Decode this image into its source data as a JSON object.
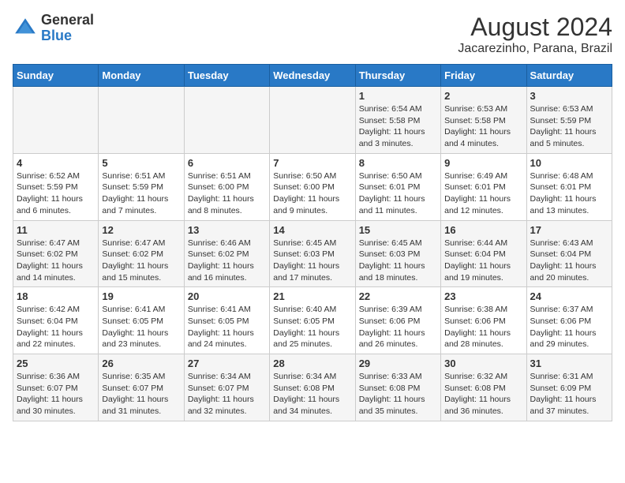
{
  "header": {
    "logo_general": "General",
    "logo_blue": "Blue",
    "month_title": "August 2024",
    "location": "Jacarezinho, Parana, Brazil"
  },
  "days_of_week": [
    "Sunday",
    "Monday",
    "Tuesday",
    "Wednesday",
    "Thursday",
    "Friday",
    "Saturday"
  ],
  "weeks": [
    [
      {
        "day": "",
        "info": ""
      },
      {
        "day": "",
        "info": ""
      },
      {
        "day": "",
        "info": ""
      },
      {
        "day": "",
        "info": ""
      },
      {
        "day": "1",
        "info": "Sunrise: 6:54 AM\nSunset: 5:58 PM\nDaylight: 11 hours and 3 minutes."
      },
      {
        "day": "2",
        "info": "Sunrise: 6:53 AM\nSunset: 5:58 PM\nDaylight: 11 hours and 4 minutes."
      },
      {
        "day": "3",
        "info": "Sunrise: 6:53 AM\nSunset: 5:59 PM\nDaylight: 11 hours and 5 minutes."
      }
    ],
    [
      {
        "day": "4",
        "info": "Sunrise: 6:52 AM\nSunset: 5:59 PM\nDaylight: 11 hours and 6 minutes."
      },
      {
        "day": "5",
        "info": "Sunrise: 6:51 AM\nSunset: 5:59 PM\nDaylight: 11 hours and 7 minutes."
      },
      {
        "day": "6",
        "info": "Sunrise: 6:51 AM\nSunset: 6:00 PM\nDaylight: 11 hours and 8 minutes."
      },
      {
        "day": "7",
        "info": "Sunrise: 6:50 AM\nSunset: 6:00 PM\nDaylight: 11 hours and 9 minutes."
      },
      {
        "day": "8",
        "info": "Sunrise: 6:50 AM\nSunset: 6:01 PM\nDaylight: 11 hours and 11 minutes."
      },
      {
        "day": "9",
        "info": "Sunrise: 6:49 AM\nSunset: 6:01 PM\nDaylight: 11 hours and 12 minutes."
      },
      {
        "day": "10",
        "info": "Sunrise: 6:48 AM\nSunset: 6:01 PM\nDaylight: 11 hours and 13 minutes."
      }
    ],
    [
      {
        "day": "11",
        "info": "Sunrise: 6:47 AM\nSunset: 6:02 PM\nDaylight: 11 hours and 14 minutes."
      },
      {
        "day": "12",
        "info": "Sunrise: 6:47 AM\nSunset: 6:02 PM\nDaylight: 11 hours and 15 minutes."
      },
      {
        "day": "13",
        "info": "Sunrise: 6:46 AM\nSunset: 6:02 PM\nDaylight: 11 hours and 16 minutes."
      },
      {
        "day": "14",
        "info": "Sunrise: 6:45 AM\nSunset: 6:03 PM\nDaylight: 11 hours and 17 minutes."
      },
      {
        "day": "15",
        "info": "Sunrise: 6:45 AM\nSunset: 6:03 PM\nDaylight: 11 hours and 18 minutes."
      },
      {
        "day": "16",
        "info": "Sunrise: 6:44 AM\nSunset: 6:04 PM\nDaylight: 11 hours and 19 minutes."
      },
      {
        "day": "17",
        "info": "Sunrise: 6:43 AM\nSunset: 6:04 PM\nDaylight: 11 hours and 20 minutes."
      }
    ],
    [
      {
        "day": "18",
        "info": "Sunrise: 6:42 AM\nSunset: 6:04 PM\nDaylight: 11 hours and 22 minutes."
      },
      {
        "day": "19",
        "info": "Sunrise: 6:41 AM\nSunset: 6:05 PM\nDaylight: 11 hours and 23 minutes."
      },
      {
        "day": "20",
        "info": "Sunrise: 6:41 AM\nSunset: 6:05 PM\nDaylight: 11 hours and 24 minutes."
      },
      {
        "day": "21",
        "info": "Sunrise: 6:40 AM\nSunset: 6:05 PM\nDaylight: 11 hours and 25 minutes."
      },
      {
        "day": "22",
        "info": "Sunrise: 6:39 AM\nSunset: 6:06 PM\nDaylight: 11 hours and 26 minutes."
      },
      {
        "day": "23",
        "info": "Sunrise: 6:38 AM\nSunset: 6:06 PM\nDaylight: 11 hours and 28 minutes."
      },
      {
        "day": "24",
        "info": "Sunrise: 6:37 AM\nSunset: 6:06 PM\nDaylight: 11 hours and 29 minutes."
      }
    ],
    [
      {
        "day": "25",
        "info": "Sunrise: 6:36 AM\nSunset: 6:07 PM\nDaylight: 11 hours and 30 minutes."
      },
      {
        "day": "26",
        "info": "Sunrise: 6:35 AM\nSunset: 6:07 PM\nDaylight: 11 hours and 31 minutes."
      },
      {
        "day": "27",
        "info": "Sunrise: 6:34 AM\nSunset: 6:07 PM\nDaylight: 11 hours and 32 minutes."
      },
      {
        "day": "28",
        "info": "Sunrise: 6:34 AM\nSunset: 6:08 PM\nDaylight: 11 hours and 34 minutes."
      },
      {
        "day": "29",
        "info": "Sunrise: 6:33 AM\nSunset: 6:08 PM\nDaylight: 11 hours and 35 minutes."
      },
      {
        "day": "30",
        "info": "Sunrise: 6:32 AM\nSunset: 6:08 PM\nDaylight: 11 hours and 36 minutes."
      },
      {
        "day": "31",
        "info": "Sunrise: 6:31 AM\nSunset: 6:09 PM\nDaylight: 11 hours and 37 minutes."
      }
    ]
  ]
}
